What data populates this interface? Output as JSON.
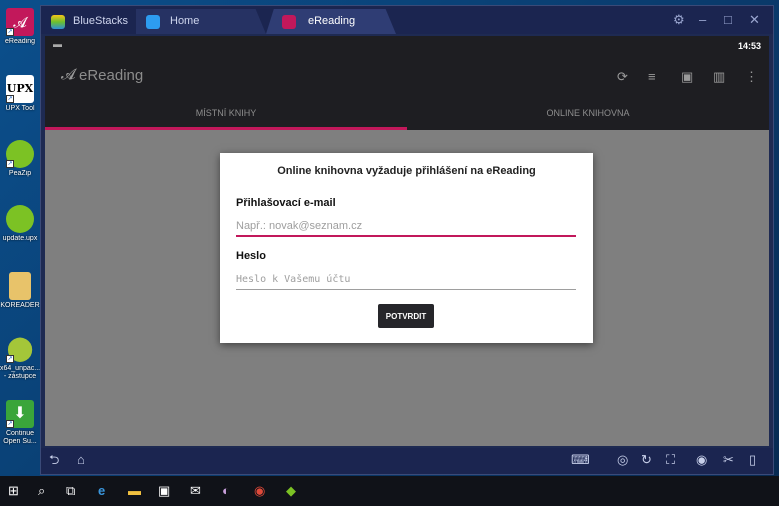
{
  "desktop": {
    "icons": [
      {
        "label": "eReading",
        "icon": "ereading-icon"
      },
      {
        "label": "UPX Tool",
        "icon": "upx-icon"
      },
      {
        "label": "PeaZip",
        "icon": "peazip-icon"
      },
      {
        "label": "update.upx",
        "icon": "peazip-icon"
      },
      {
        "label": "KOREADER",
        "icon": "folder-icon"
      },
      {
        "label": "x64_unpac... - zástupce",
        "icon": "android-icon"
      },
      {
        "label": "Continue Open Su...",
        "icon": "download-icon"
      }
    ],
    "upx_text": "UPX"
  },
  "bluestacks": {
    "tabs": [
      {
        "label": "BlueStacks"
      },
      {
        "label": "Home"
      },
      {
        "label": "eReading"
      }
    ],
    "window_controls": [
      "gear-icon",
      "minimize-icon",
      "maximize-icon",
      "close-icon"
    ]
  },
  "android": {
    "status_time": "14:53",
    "app_title": "eReading",
    "tabs": [
      {
        "label": "MÍSTNÍ KNIHY",
        "active": true
      },
      {
        "label": "ONLINE KNIHOVNA",
        "active": false
      }
    ],
    "accent_color": "#c2185b"
  },
  "dialog": {
    "title": "Online knihovna vyžaduje přihlášení na eReading",
    "email_label": "Přihlašovací e-mail",
    "email_placeholder": "Např.: novak@seznam.cz",
    "email_value": "",
    "password_label": "Heslo",
    "password_placeholder": "Heslo k Vašemu účtu",
    "password_value": "",
    "confirm_label": "POTVRDIT"
  }
}
